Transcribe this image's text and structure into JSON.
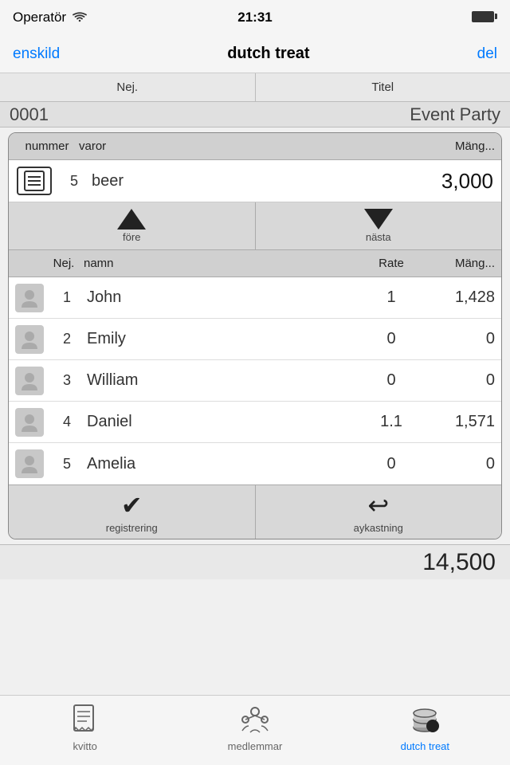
{
  "statusBar": {
    "carrier": "Operatör",
    "time": "21:31"
  },
  "navBar": {
    "backLabel": "enskild",
    "title": "dutch treat",
    "actionLabel": "del"
  },
  "segmentTabs": {
    "tab1": "Nej.",
    "tab2": "Titel"
  },
  "numberRow": {
    "number": "0001",
    "eventName": "Event Party"
  },
  "itemTable": {
    "headers": {
      "nummer": "nummer",
      "varor": "varor",
      "mangd": "Mäng..."
    },
    "selectedItem": {
      "num": "5",
      "name": "beer",
      "amount": "3,000"
    }
  },
  "navigation": {
    "prevLabel": "före",
    "nextLabel": "nästa"
  },
  "personTable": {
    "headers": {
      "nej": "Nej.",
      "namn": "namn",
      "rate": "Rate",
      "mangd": "Mäng..."
    },
    "persons": [
      {
        "num": "1",
        "name": "John",
        "rate": "1",
        "amount": "1,428"
      },
      {
        "num": "2",
        "name": "Emily",
        "rate": "0",
        "amount": "0"
      },
      {
        "num": "3",
        "name": "William",
        "rate": "0",
        "amount": "0"
      },
      {
        "num": "4",
        "name": "Daniel",
        "rate": "1.1",
        "amount": "1,571"
      },
      {
        "num": "5",
        "name": "Amelia",
        "rate": "0",
        "amount": "0"
      }
    ]
  },
  "actions": {
    "registerLabel": "registrering",
    "discardLabel": "aykastning"
  },
  "total": {
    "value": "14,500"
  },
  "tabBar": {
    "tabs": [
      {
        "id": "kvitto",
        "label": "kvitto",
        "active": false
      },
      {
        "id": "medlemmar",
        "label": "medlemmar",
        "active": false
      },
      {
        "id": "dutch-treat",
        "label": "dutch treat",
        "active": true
      }
    ]
  }
}
